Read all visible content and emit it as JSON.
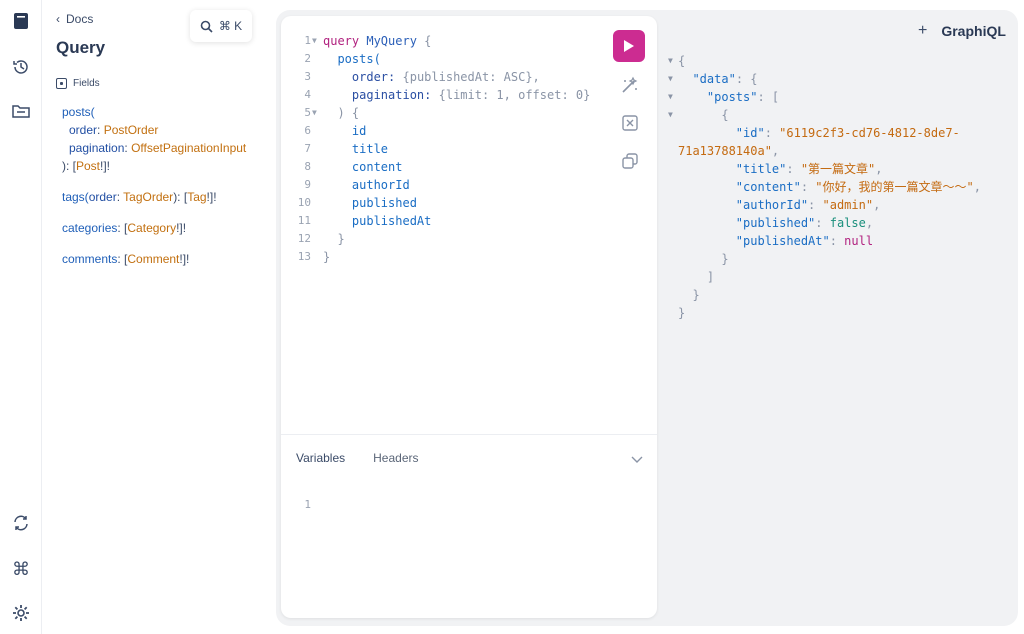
{
  "docs": {
    "back_label": "Docs",
    "title": "Query",
    "fields_label": "Fields",
    "search_shortcut": "⌘ K",
    "fields": {
      "posts": {
        "name": "posts(",
        "args": [
          {
            "name": "order",
            "type": "PostOrder"
          },
          {
            "name": "pagination",
            "type": "OffsetPaginationInput"
          }
        ],
        "ret_open": "): [",
        "ret_type": "Post",
        "ret_close": "!]!"
      },
      "tags": {
        "name": "tags(",
        "arg": "order",
        "arg_type": "TagOrder",
        "mid": "): [",
        "type": "Tag",
        "close": "!]!"
      },
      "categories": {
        "name": "categories",
        "mid": ": [",
        "type": "Category",
        "close": "!]!"
      },
      "comments": {
        "name": "comments",
        "mid": ": [",
        "type": "Comment",
        "close": "!]!"
      }
    }
  },
  "editor": {
    "line_numbers": [
      "1",
      "2",
      "3",
      "4",
      "5",
      "6",
      "7",
      "8",
      "9",
      "10",
      "11",
      "12",
      "13"
    ],
    "query_kw": "query",
    "query_name": "MyQuery",
    "open_brace": "{",
    "posts": "posts(",
    "order_key": "order:",
    "order_val": "{publishedAt: ASC},",
    "pagination_key": "pagination:",
    "pagination_val": "{limit: 1, offset: 0}",
    "close_args": ") {",
    "fields": [
      "id",
      "title",
      "content",
      "authorId",
      "published",
      "publishedAt"
    ],
    "close_inner": "}",
    "close_outer": "}"
  },
  "variables": {
    "tab_variables": "Variables",
    "tab_headers": "Headers",
    "line1": "1"
  },
  "result": {
    "brand": "GraphiQL",
    "brand_plus": "+",
    "open": "{",
    "data_key": "\"data\"",
    "posts_key": "\"posts\"",
    "id_key": "\"id\"",
    "id_val_1": "\"6119c2f3-cd76-4812-8de7-",
    "id_val_2": "71a13788140a\"",
    "title_key": "\"title\"",
    "title_val": "\"第一篇文章\"",
    "content_key": "\"content\"",
    "content_val": "\"你好，我的第一篇文章～～\"",
    "authorId_key": "\"authorId\"",
    "authorId_val": "\"admin\"",
    "published_key": "\"published\"",
    "published_val": "false",
    "publishedAt_key": "\"publishedAt\"",
    "publishedAt_val": "null"
  },
  "icons": {
    "rail": [
      "docs-icon",
      "history-icon",
      "explorer-icon",
      "refetch-schema-icon",
      "shortcuts-icon",
      "settings-icon"
    ],
    "editor_tools": [
      "prettify-icon",
      "merge-fragments-icon",
      "copy-icon"
    ]
  },
  "colors": {
    "run_button": "#cc2c91",
    "field": "#1a6dc4",
    "type": "#c27010",
    "string": "#c46a10",
    "keyword": "#b1227f"
  }
}
